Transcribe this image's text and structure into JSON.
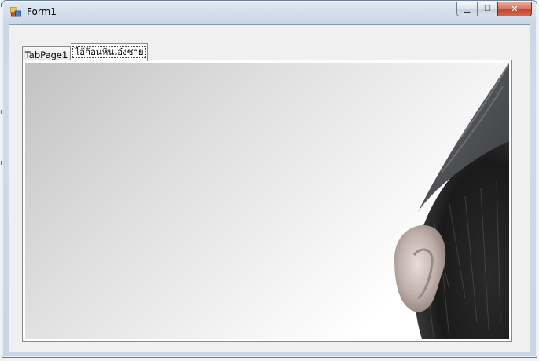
{
  "window": {
    "title": "Form1",
    "minimize_symbol": "▁",
    "maximize_symbol": "☐",
    "close_symbol": "✕"
  },
  "tabs": [
    {
      "label": "TabPage1",
      "selected": false
    },
    {
      "label": "ไอ้ก้อนหินเอ๋งชาย",
      "selected": true
    }
  ],
  "picture": {
    "content": "photo of a dark furry creature with an ear and a knit cap"
  },
  "colors": {
    "titlebar": "#c9d7e6",
    "close_button": "#c3452a",
    "client_background": "#f0f0f0"
  },
  "icons": [
    "app-icon",
    "minimize-icon",
    "maximize-icon",
    "close-icon"
  ]
}
